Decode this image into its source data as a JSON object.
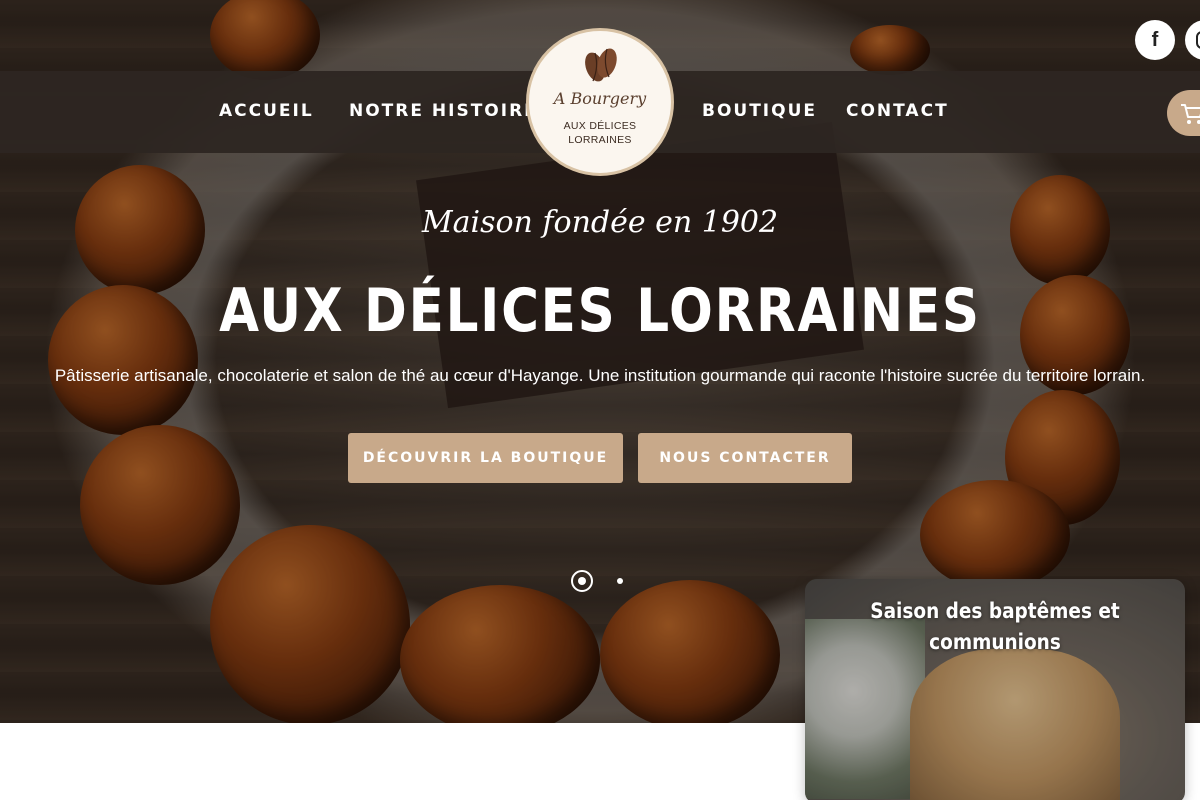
{
  "nav": {
    "items": [
      {
        "label": "ACCUEIL"
      },
      {
        "label": "NOTRE HISTOIRE"
      },
      {
        "label": "BOUTIQUE"
      },
      {
        "label": "CONTACT"
      }
    ]
  },
  "logo": {
    "script": "A Bourgery",
    "line1": "AUX DÉLICES",
    "line2": "LORRAINES"
  },
  "social": [
    {
      "icon": "facebook-icon",
      "glyph": "f"
    },
    {
      "icon": "instagram-icon",
      "glyph": ""
    }
  ],
  "cart": {
    "icon": "cart-icon"
  },
  "hero": {
    "tagline": "Maison fondée en 1902",
    "headline": "AUX DÉLICES LORRAINES",
    "intro": "Pâtisserie artisanale, chocolaterie et salon de thé au cœur d'Hayange. Une institution gourmande qui raconte l'histoire sucrée du territoire lorrain.",
    "primary_button": "DÉCOUVRIR LA BOUTIQUE",
    "secondary_button": "NOUS CONTACTER"
  },
  "carousel": {
    "slides": 2,
    "active": 1
  },
  "promo": {
    "title": "Saison des baptêmes et communions"
  },
  "colors": {
    "accent": "#c8a98a",
    "nav_bg": "#2d2622",
    "text_light": "#ffffff"
  }
}
